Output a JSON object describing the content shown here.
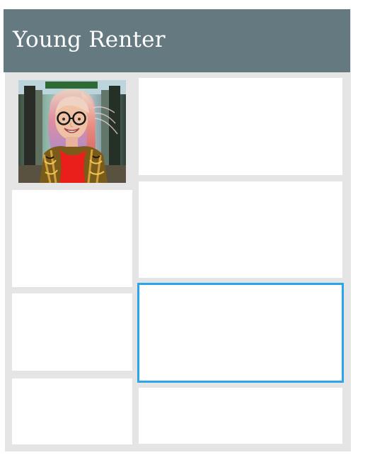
{
  "header": {
    "title": "Young Renter"
  },
  "profile": {
    "photo_icon": "person-photo-icon"
  },
  "colors": {
    "header_bg": "#657a80",
    "panel_bg": "#e5e5e5",
    "card_bg": "#ffffff",
    "selected_border": "#2aa4ea"
  },
  "cards": [
    {
      "id": "left-1",
      "selected": false
    },
    {
      "id": "left-2",
      "selected": false
    },
    {
      "id": "left-3",
      "selected": false
    },
    {
      "id": "right-1",
      "selected": false
    },
    {
      "id": "right-2",
      "selected": false
    },
    {
      "id": "right-3",
      "selected": true
    },
    {
      "id": "right-4",
      "selected": false
    }
  ]
}
